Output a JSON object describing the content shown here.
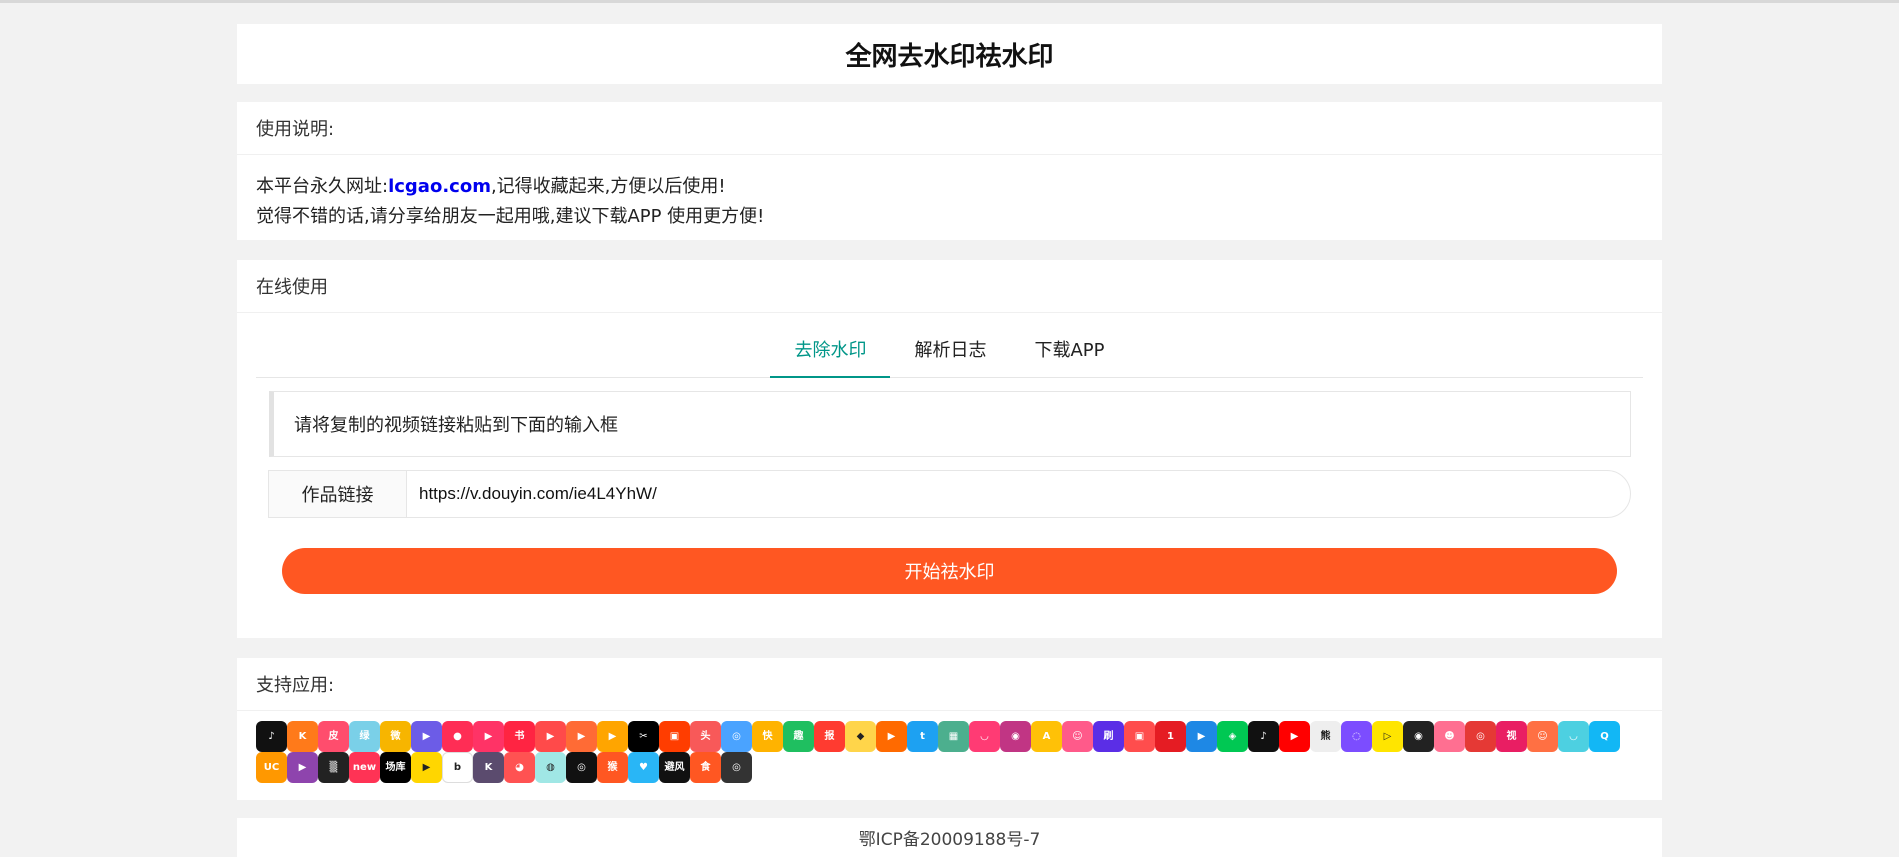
{
  "page": {
    "title": "全网去水印祛水印"
  },
  "notice": {
    "header": "使用说明:",
    "line1_prefix": "本平台永久网址:",
    "link": "lcgao.com",
    "line1_suffix": ",记得收藏起来,方便以后使用!",
    "line2": "觉得不错的话,请分享给朋友一起用哦,建议下载APP 使用更方便!"
  },
  "online": {
    "header": "在线使用",
    "tabs": [
      {
        "label": "去除水印",
        "active": true
      },
      {
        "label": "解析日志",
        "active": false
      },
      {
        "label": "下载APP",
        "active": false
      }
    ],
    "hint": "请将复制的视频链接粘贴到下面的输入框",
    "input_label": "作品链接",
    "input_value": "https://v.douyin.com/ie4L4YhW/",
    "start_button": "开始祛水印"
  },
  "support": {
    "header": "支持应用:",
    "apps": [
      {
        "name": "douyin-icon",
        "color": "#111111",
        "glyph": "♪"
      },
      {
        "name": "kuaishou-icon",
        "color": "#ff7a1a",
        "glyph": "K"
      },
      {
        "name": "pipixia-icon",
        "color": "#ff4d6d",
        "glyph": "皮"
      },
      {
        "name": "lvzhou-icon",
        "color": "#7ad0e8",
        "glyph": "绿"
      },
      {
        "name": "weibo-icon",
        "color": "#f7b500",
        "glyph": "微"
      },
      {
        "name": "weishi-icon",
        "color": "#6c5ce7",
        "glyph": "▶"
      },
      {
        "name": "meipai-icon",
        "color": "#ff2d55",
        "glyph": "●"
      },
      {
        "name": "haokan-icon",
        "color": "#ff3366",
        "glyph": "▶"
      },
      {
        "name": "xiaohongshu-icon",
        "color": "#ff2442",
        "glyph": "书"
      },
      {
        "name": "xigua-icon",
        "color": "#ff4a4a",
        "glyph": "▶"
      },
      {
        "name": "huoshan-icon",
        "color": "#ff6b35",
        "glyph": "▶"
      },
      {
        "name": "weishi2-icon",
        "color": "#ffa500",
        "glyph": "▶"
      },
      {
        "name": "capcut-icon",
        "color": "#000000",
        "glyph": "✂"
      },
      {
        "name": "live-icon",
        "color": "#ff3d00",
        "glyph": "▣"
      },
      {
        "name": "toutiao-icon",
        "color": "#f85959",
        "glyph": "头"
      },
      {
        "name": "zuiyou-icon",
        "color": "#4aa3ff",
        "glyph": "◎"
      },
      {
        "name": "kuai-icon",
        "color": "#ffb300",
        "glyph": "快"
      },
      {
        "name": "qutoutiao-icon",
        "color": "#1fbf60",
        "glyph": "趣"
      },
      {
        "name": "kuaibao-icon",
        "color": "#ff3b30",
        "glyph": "报"
      },
      {
        "name": "chick-icon",
        "color": "#ffd54a",
        "glyph": "◆"
      },
      {
        "name": "play-orange-icon",
        "color": "#ff6a00",
        "glyph": "▶"
      },
      {
        "name": "twitter-icon",
        "color": "#1da1f2",
        "glyph": "t"
      },
      {
        "name": "douban-icon",
        "color": "#4caf8e",
        "glyph": "▦"
      },
      {
        "name": "momo-icon",
        "color": "#ff3b74",
        "glyph": "◡"
      },
      {
        "name": "instagram-icon",
        "color": "#c13584",
        "glyph": "◉"
      },
      {
        "name": "acfun-icon",
        "color": "#ffc107",
        "glyph": "A"
      },
      {
        "name": "face-icon",
        "color": "#ff5a8a",
        "glyph": "☺"
      },
      {
        "name": "gang-icon",
        "color": "#5b2ee6",
        "glyph": "刷"
      },
      {
        "name": "tv-icon",
        "color": "#ff4d4d",
        "glyph": "▣"
      },
      {
        "name": "yidian-icon",
        "color": "#e51c23",
        "glyph": "1"
      },
      {
        "name": "youku-icon",
        "color": "#1e88e5",
        "glyph": "▶"
      },
      {
        "name": "iqiyi-icon",
        "color": "#00c853",
        "glyph": "◈"
      },
      {
        "name": "tiktok-icon",
        "color": "#111111",
        "glyph": "♪"
      },
      {
        "name": "youtube-icon",
        "color": "#ff0000",
        "glyph": "▶"
      },
      {
        "name": "bear-icon",
        "color": "#eeeeee",
        "glyph": "熊"
      },
      {
        "name": "chat-icon",
        "color": "#7c4dff",
        "glyph": "◌"
      },
      {
        "name": "yellow-play-icon",
        "color": "#ffe500",
        "glyph": "▷"
      },
      {
        "name": "eye-icon",
        "color": "#222222",
        "glyph": "◉"
      },
      {
        "name": "girl-icon",
        "color": "#ff6f91",
        "glyph": "☻"
      },
      {
        "name": "netease-icon",
        "color": "#e53935",
        "glyph": "◎"
      },
      {
        "name": "shipin-icon",
        "color": "#e91e63",
        "glyph": "视"
      },
      {
        "name": "cartoon-icon",
        "color": "#ff7043",
        "glyph": "☺"
      },
      {
        "name": "bowl-icon",
        "color": "#4dd0e1",
        "glyph": "◡"
      },
      {
        "name": "qq-icon",
        "color": "#12b7f5",
        "glyph": "Q"
      },
      {
        "name": "uc-icon",
        "color": "#ff9800",
        "glyph": "UC"
      },
      {
        "name": "purple-icon",
        "color": "#8e44ad",
        "glyph": "▶"
      },
      {
        "name": "stripe-icon",
        "color": "#222222",
        "glyph": "▒"
      },
      {
        "name": "new-icon",
        "color": "#ff3355",
        "glyph": "new"
      },
      {
        "name": "changku-icon",
        "color": "#000000",
        "glyph": "场库"
      },
      {
        "name": "yellow-tv-icon",
        "color": "#ffd600",
        "glyph": "▶"
      },
      {
        "name": "b-icon",
        "color": "#ffffff",
        "glyph": "b"
      },
      {
        "name": "k-icon",
        "color": "#5b4b6e",
        "glyph": "K"
      },
      {
        "name": "red-circle-icon",
        "color": "#ff5252",
        "glyph": "◕"
      },
      {
        "name": "pastel-icon",
        "color": "#a0e7e5",
        "glyph": "◍"
      },
      {
        "name": "mouth-icon",
        "color": "#111111",
        "glyph": "◎"
      },
      {
        "name": "monkey-icon",
        "color": "#ff5722",
        "glyph": "猴"
      },
      {
        "name": "heart-icon",
        "color": "#29b6f6",
        "glyph": "♥"
      },
      {
        "name": "bifeng-icon",
        "color": "#111111",
        "glyph": "避风"
      },
      {
        "name": "shi-icon",
        "color": "#ff5722",
        "glyph": "食"
      },
      {
        "name": "ring-icon",
        "color": "#333333",
        "glyph": "◎"
      }
    ]
  },
  "footer": {
    "icp": "鄂ICP备20009188号-7"
  }
}
